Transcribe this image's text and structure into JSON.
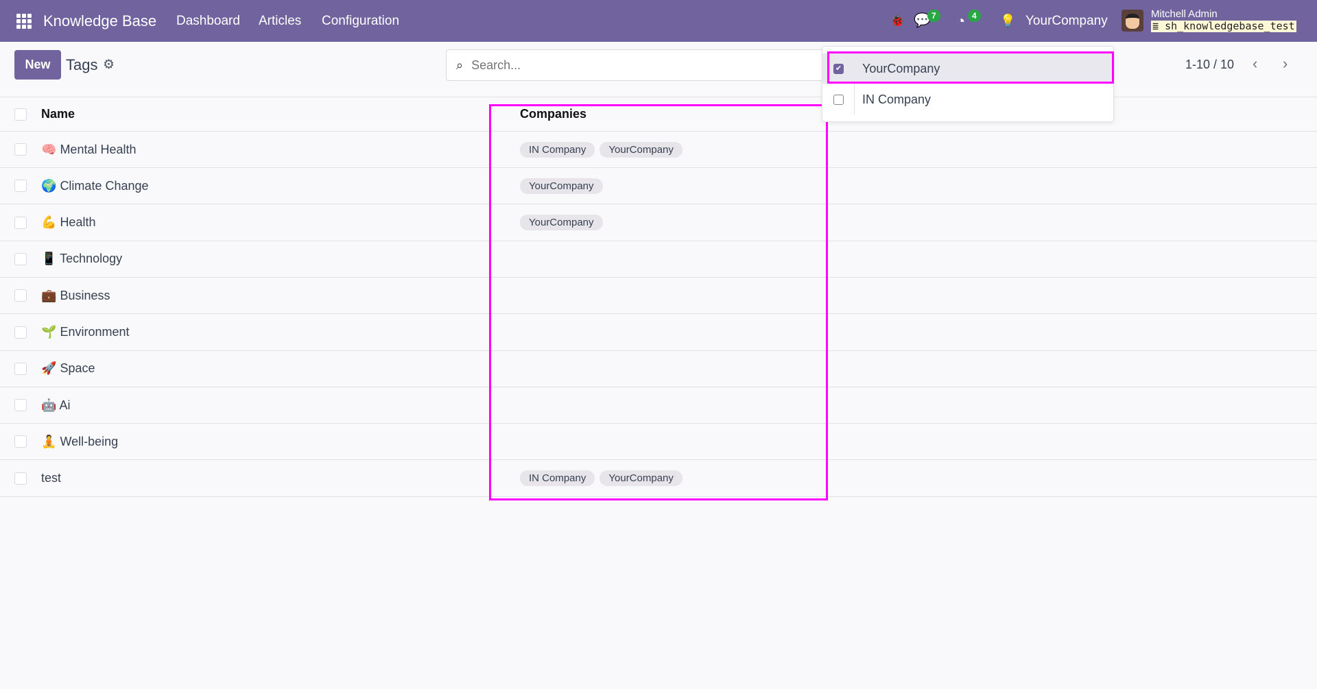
{
  "navbar": {
    "app_title": "Knowledge Base",
    "menu": [
      "Dashboard",
      "Articles",
      "Configuration"
    ],
    "messages_badge": "7",
    "activities_badge": "4",
    "company": "YourCompany",
    "user_name": "Mitchell Admin",
    "database": "sh_knowledgebase_test"
  },
  "control_panel": {
    "new_label": "New",
    "breadcrumb": "Tags",
    "search_placeholder": "Search...",
    "pager": "1-10 / 10"
  },
  "company_switcher": {
    "items": [
      {
        "label": "YourCompany",
        "checked": true
      },
      {
        "label": "IN Company",
        "checked": false
      }
    ]
  },
  "table": {
    "headers": {
      "name": "Name",
      "companies": "Companies"
    },
    "rows": [
      {
        "emoji": "🧠",
        "name": "Mental Health",
        "companies": [
          "IN Company",
          "YourCompany"
        ]
      },
      {
        "emoji": "🌍",
        "name": "Climate Change",
        "companies": [
          "YourCompany"
        ]
      },
      {
        "emoji": "💪",
        "name": "Health",
        "companies": [
          "YourCompany"
        ]
      },
      {
        "emoji": "📱",
        "name": "Technology",
        "companies": []
      },
      {
        "emoji": "💼",
        "name": "Business",
        "companies": []
      },
      {
        "emoji": "🌱",
        "name": "Environment",
        "companies": []
      },
      {
        "emoji": "🚀",
        "name": "Space",
        "companies": []
      },
      {
        "emoji": "🤖",
        "name": "Ai",
        "companies": []
      },
      {
        "emoji": "🧘",
        "name": "Well-being",
        "companies": []
      },
      {
        "emoji": "",
        "name": "test",
        "companies": [
          "IN Company",
          "YourCompany"
        ]
      }
    ]
  },
  "colors": {
    "brand": "#71639e",
    "highlight": "#ff00ff",
    "badge": "#28a745"
  }
}
